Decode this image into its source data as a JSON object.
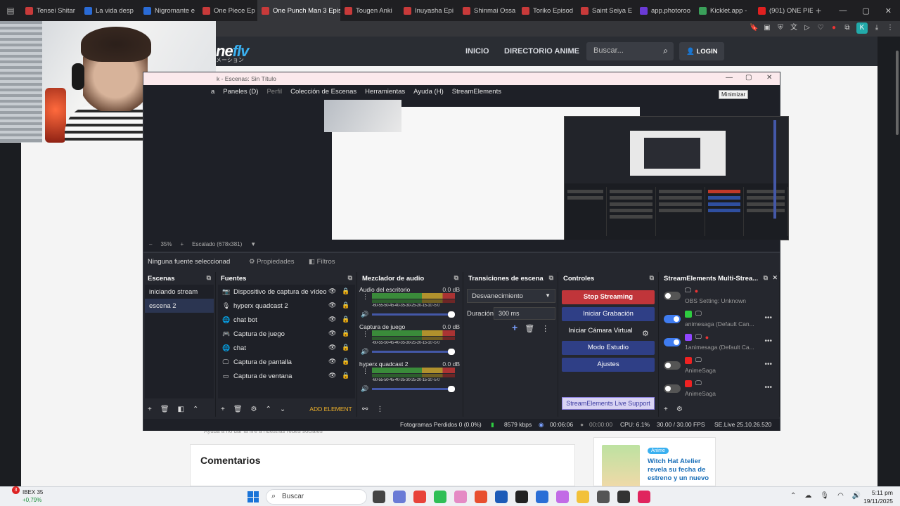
{
  "browser": {
    "tabs": [
      {
        "label": "Tensei Shitar",
        "color": "#c83a3a"
      },
      {
        "label": "La vida desp",
        "color": "#2a6bd6"
      },
      {
        "label": "Nigromante e",
        "color": "#2a6bd6"
      },
      {
        "label": "One Piece Ep",
        "color": "#c83a3a"
      },
      {
        "label": "One Punch Man 3 Episo",
        "color": "#c83a3a",
        "active": true
      },
      {
        "label": "Tougen Anki",
        "color": "#c83a3a"
      },
      {
        "label": "Inuyasha Epi",
        "color": "#c83a3a"
      },
      {
        "label": "Shinmai Ossa",
        "color": "#c83a3a"
      },
      {
        "label": "Toriko Episod",
        "color": "#c83a3a"
      },
      {
        "label": "Saint Seiya E",
        "color": "#c83a3a"
      },
      {
        "label": "app.photoroo",
        "color": "#6a3ad6"
      },
      {
        "label": "Kicklet.app -",
        "color": "#3aa05a"
      },
      {
        "label": "(901) ONE PIE",
        "color": "#e02020"
      }
    ],
    "profile_letter": "K"
  },
  "site": {
    "logo": "ne",
    "logo_accent": "flv",
    "logo_sub": "メーション",
    "nav": [
      "INICIO",
      "DIRECTORIO ANIME"
    ],
    "search_placeholder": "Buscar...",
    "login": "LOGIN",
    "caption": "Ayuda a no dar la fire a nuestras redes sociales",
    "comments_title": "Comentarios",
    "news_badge": "Anime",
    "news_text": "Witch Hat Atelier revela su fecha de estreno y un nuevo"
  },
  "obs": {
    "title": "k - Escenas: Sin Título",
    "tooltip": "Minimizar",
    "menu": [
      "a",
      "Paneles (D)",
      "Perfil",
      "Colección de Escenas",
      "Herramientas",
      "Ayuda (H)",
      "StreamElements"
    ],
    "zoom": {
      "minus": "–",
      "percent": "35%",
      "plus": "+",
      "scale": "Escalado (678x381)"
    },
    "no_source": "Ninguna fuente seleccionad",
    "properties": "Propiedades",
    "filters": "Filtros",
    "scenes_title": "Escenas",
    "scenes": [
      "iniciando stream",
      "escena 2"
    ],
    "sources_title": "Fuentes",
    "sources": [
      {
        "icon": "camera-icon",
        "glyph": "📷",
        "label": "Dispositivo de captura de vídeo"
      },
      {
        "icon": "microphone-icon",
        "glyph": "🎙",
        "label": "hyperx quadcast 2"
      },
      {
        "icon": "globe-icon",
        "glyph": "🌐",
        "label": "chat bot"
      },
      {
        "icon": "gamepad-icon",
        "glyph": "🎮",
        "label": "Captura de juego"
      },
      {
        "icon": "globe-icon",
        "glyph": "🌐",
        "label": "chat"
      },
      {
        "icon": "monitor-icon",
        "glyph": "🖵",
        "label": "Captura de pantalla"
      },
      {
        "icon": "window-icon",
        "glyph": "▭",
        "label": "Captura de ventana"
      }
    ],
    "add_element": "ADD ELEMENT",
    "mixer_title": "Mezclador de audio",
    "mixer": [
      {
        "name": "Audio del escritorio",
        "db": "0.0 dB"
      },
      {
        "name": "Captura de juego",
        "db": "0.0 dB"
      },
      {
        "name": "hyperx quadcast 2",
        "db": "0.0 dB"
      }
    ],
    "mixer_scale": "-60-55-50-45-40-35-30-25-20-15-10 -5 0",
    "transitions_title": "Transiciones de escena",
    "transition": "Desvanecimiento",
    "duration_label": "Duración",
    "duration": "300 ms",
    "controls_title": "Controles",
    "controls": [
      "Stop Streaming",
      "Iniciar Grabación",
      "Iniciar Cámara Virtual",
      "Modo Estudio",
      "Ajustes"
    ],
    "se_support": "StreamElements Live Support",
    "se_title": "StreamElements Multi-Strea...",
    "se_rows": [
      {
        "on": false,
        "label": "OBS Setting: Unknown",
        "platform": "",
        "live": true
      },
      {
        "on": true,
        "label": "animesaga (Default Can...",
        "platform": "#2ecc40",
        "live": false
      },
      {
        "on": true,
        "label": "1animesaga (Default Ca...",
        "platform": "#9146ff",
        "live": true
      },
      {
        "on": false,
        "label": "AnimeSaga",
        "platform": "#e22",
        "live": false
      },
      {
        "on": false,
        "label": "AnimeSaga",
        "platform": "#e22",
        "live": false
      }
    ],
    "status": {
      "dropped": "Fotogramas Perdidos 0 (0.0%)",
      "kbps": "8579 kbps",
      "stream_time": "00:06:06",
      "rec_time": "00:00:00",
      "cpu": "CPU: 6.1%",
      "fps": "30.00 / 30.00 FPS",
      "version": "SE.Live 25.10.26.520"
    }
  },
  "taskbar": {
    "ibex_name": "IBEX 35",
    "ibex_change": "+0,79%",
    "ibex_badge": "3",
    "search": "Buscar",
    "time": "5:11 pm",
    "date": "19/11/2025",
    "apps": [
      "#444",
      "#6a7bd6",
      "#e8433a",
      "#2fbf56",
      "#e58ac4",
      "#e84f2f",
      "#1c5bb8",
      "#222",
      "#2a6ed6",
      "#c26be6",
      "#f2c13a",
      "#555",
      "#333",
      "#e0245e"
    ]
  }
}
